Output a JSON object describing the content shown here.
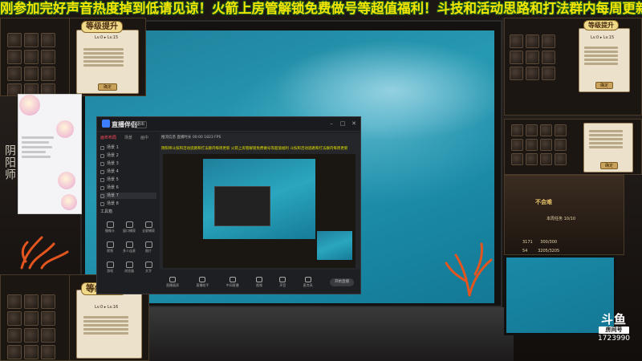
{
  "ticker": {
    "text": "刚参加完好声音热度掉到低请见谅！火箭上房管解锁免费做号等超值福利！斗技和活动思路和打法群内每周更新"
  },
  "colors": {
    "ticker_text": "#f3e500",
    "ocean": "#1f8aa6",
    "app_accent": "#ff4a5a",
    "card_bg": "#ece1cb"
  },
  "upgrade_panels": {
    "title": "等级提升",
    "lv_from": "Lv.0",
    "lv_to": "Lv.15",
    "confirm": "确定",
    "bottom_left_lv_from": "Lv.0",
    "bottom_left_lv_to": "Lv.16"
  },
  "app": {
    "name": "直播伴侣",
    "badge": "退出",
    "tabs": [
      "画布布局",
      "场景",
      "画中"
    ],
    "scenes": [
      "场景 1",
      "场景 2",
      "场景 3",
      "场景 4",
      "场景 5",
      "场景 6",
      "场景 7",
      "场景 8"
    ],
    "tools_title": "工具箱",
    "tools": [
      "摄像头",
      "窗口捕获",
      "全屏捕获",
      "视频",
      "多人连麦",
      "图片",
      "游戏",
      "浏览器",
      "文字"
    ],
    "bottom_tools": [
      "直播画质",
      "直播助手",
      "中间直播",
      "视频",
      "声音",
      "麦克风"
    ],
    "live_button": "开始直播",
    "info_text": "推流信息 直播时长 00:00 1823 FPS",
    "notice_text": "阴阳师斗技和活动思路和打法群内每周更新 火箭上房管解锁免费做号等超值福利 斗技和活动思路和打法群内每周更新"
  },
  "game_panel": {
    "title": "不会难",
    "subtitle": "本周任务 10/10",
    "gold_1": "3171",
    "gold_1_cap": "300/300",
    "gold_2": "54",
    "gold_2_cap": "3205/3205"
  },
  "side_text": "阴阳师",
  "douyu": {
    "logo": "斗鱼",
    "room_label": "房间号",
    "room_number": "1723990"
  },
  "icons": {
    "minimize": "minimize-icon",
    "maximize": "maximize-icon",
    "close": "close-icon"
  }
}
